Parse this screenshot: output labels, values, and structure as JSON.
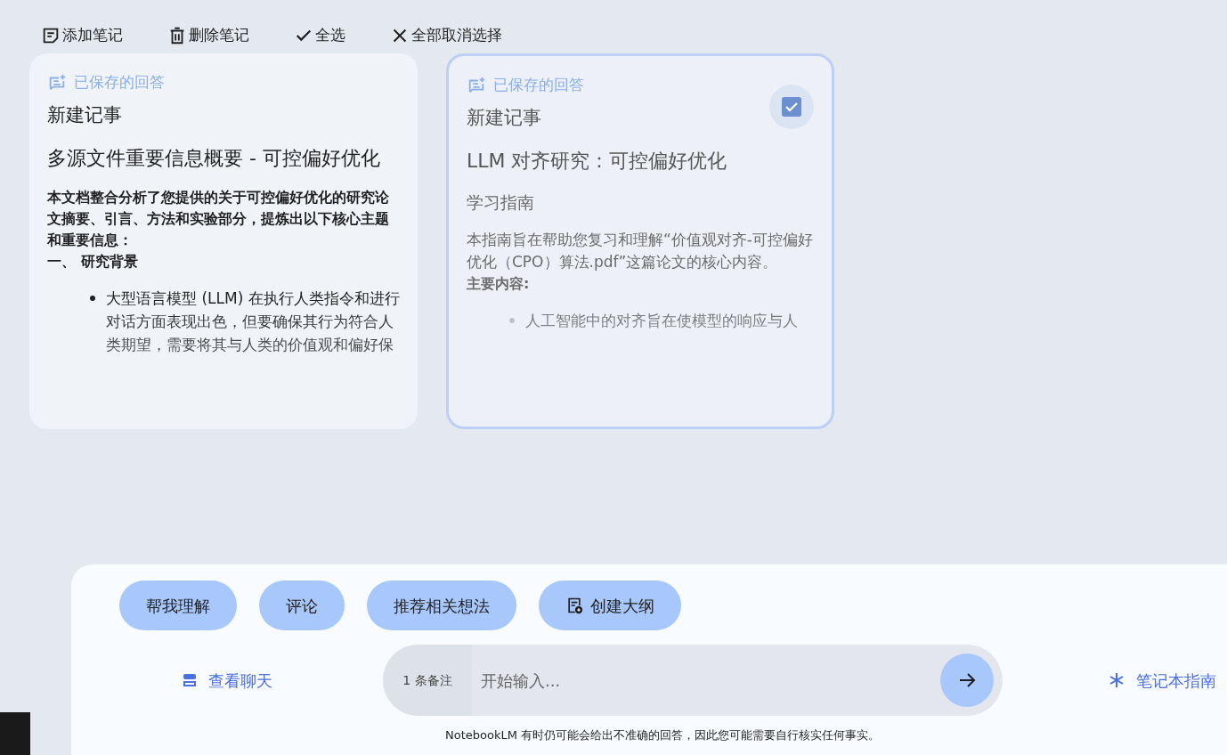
{
  "toolbar": [
    {
      "kind": "add",
      "label": "添加笔记"
    },
    {
      "kind": "delete",
      "label": "删除笔记"
    },
    {
      "kind": "check",
      "label": "全选"
    },
    {
      "kind": "close",
      "label": "全部取消选择"
    }
  ],
  "notes": [
    {
      "selected": false,
      "tag": "已保存的回答",
      "title": "新建记事",
      "heading": "多源文件重要信息概要 - 可控偏好优化",
      "blocks": [
        {
          "kind": "bold",
          "text": "本文档整合分析了您提供的关于可控偏好优化的研究论文摘要、引言、方法和实验部分，提炼出以下核心主题和重要信息："
        },
        {
          "kind": "bold",
          "text": "一、 研究背景"
        },
        {
          "kind": "bullet",
          "text": "大型语言模型 (LLM) 在执行人类指令和进行对话方面表现出色，但要确保其行为符合人类期望，需要将其与人类的价值观和偏好保"
        }
      ]
    },
    {
      "selected": true,
      "tag": "已保存的回答",
      "title": "新建记事",
      "heading": "LLM 对齐研究：可控偏好优化",
      "blocks": [
        {
          "kind": "sub",
          "text": "学习指南"
        },
        {
          "kind": "text",
          "text": "本指南旨在帮助您复习和理解“价值观对齐-可控偏好优化（CPO）算法.pdf”这篇论文的核心内容。"
        },
        {
          "kind": "bold",
          "text": "主要内容:"
        },
        {
          "kind": "bullet",
          "text": "人工智能中的对齐旨在使模型的响应与人"
        }
      ]
    }
  ],
  "chips": [
    {
      "kind": "plain",
      "label": "帮我理解"
    },
    {
      "kind": "plain",
      "label": "评论"
    },
    {
      "kind": "plain",
      "label": "推荐相关想法"
    },
    {
      "kind": "outline",
      "label": "创建大纲"
    }
  ],
  "chat_link": "查看聊天",
  "composer": {
    "source_count": "1 条备注",
    "placeholder": "开始输入..."
  },
  "guide_link": "笔记本指南",
  "disclaimer": "NotebookLM 有时仍可能会给出不准确的回答，因此您可能需要自行核实任何事实。"
}
